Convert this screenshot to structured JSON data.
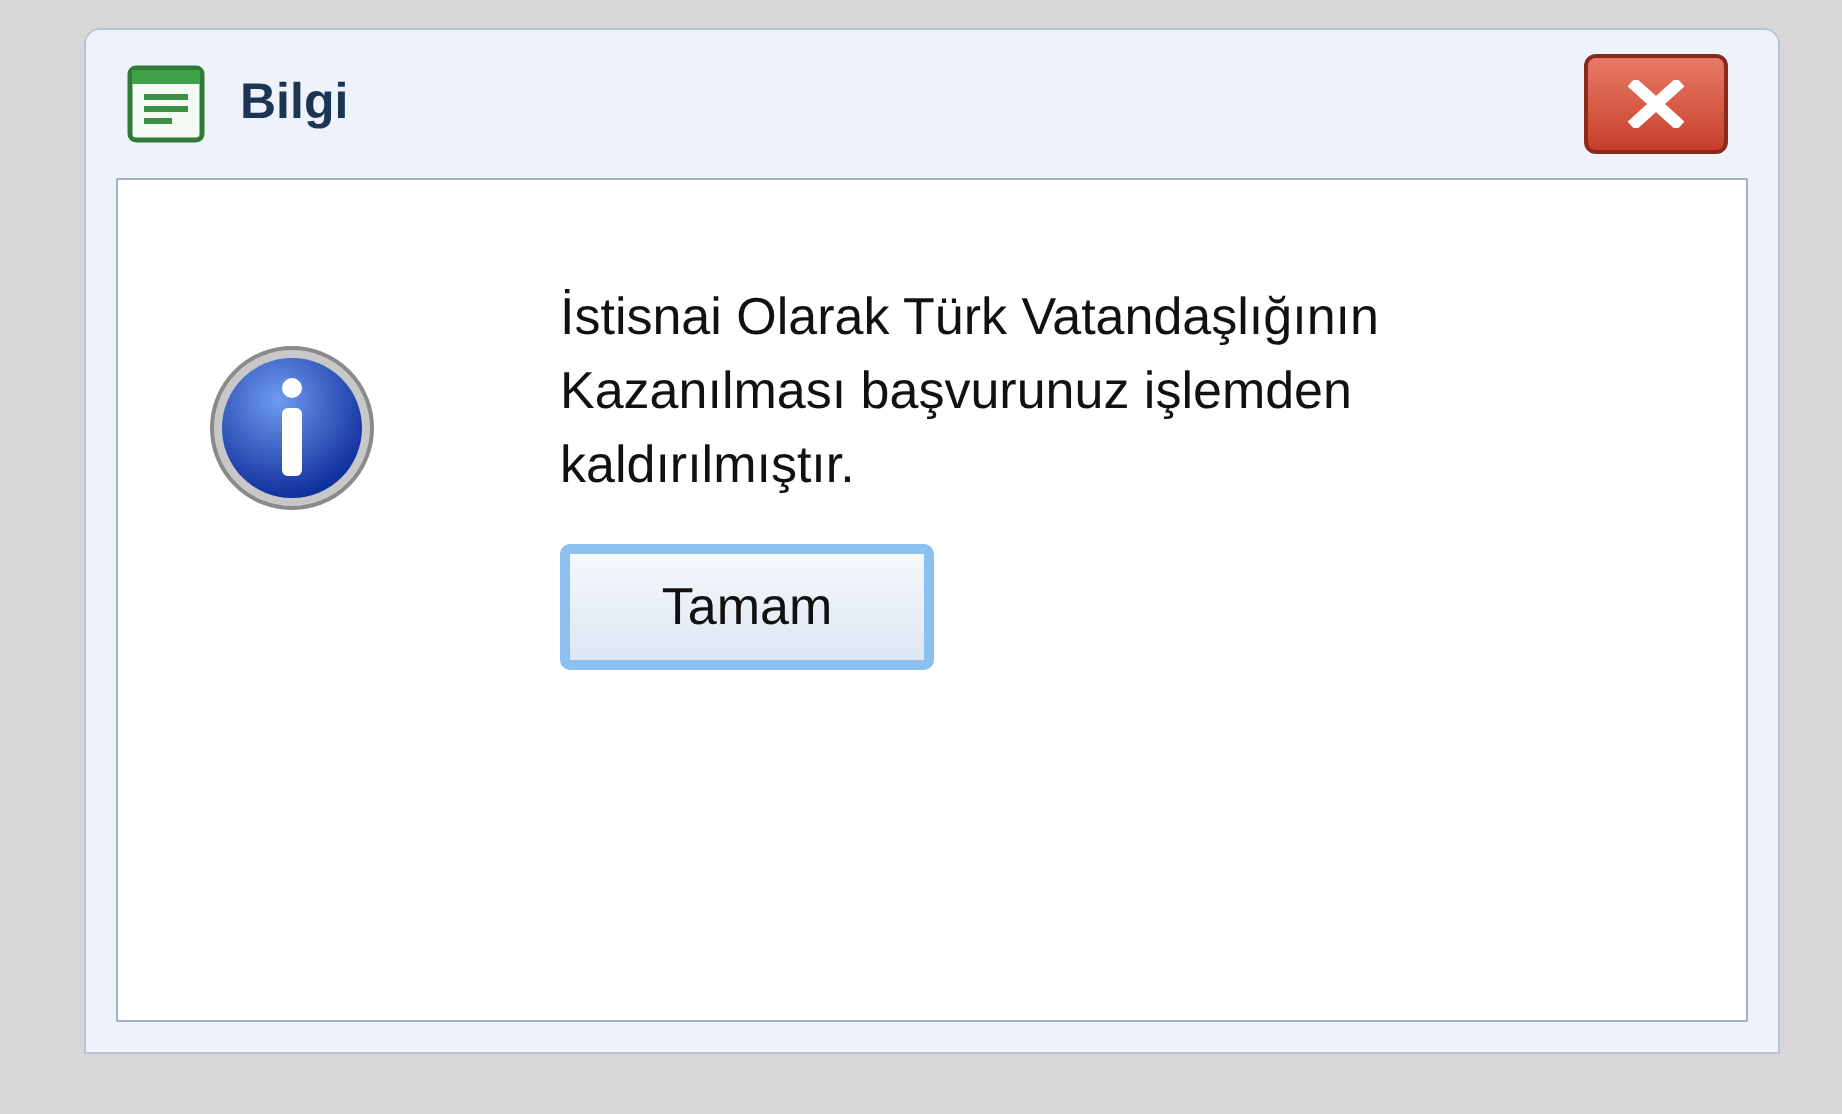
{
  "window": {
    "title": "Bilgi"
  },
  "message": "İstisnai Olarak Türk Vatandaşlığının Kazanılması başvurunuz işlemden kaldırılmıştır.",
  "buttons": [
    {
      "label": "Tamam",
      "focused": true
    }
  ]
}
